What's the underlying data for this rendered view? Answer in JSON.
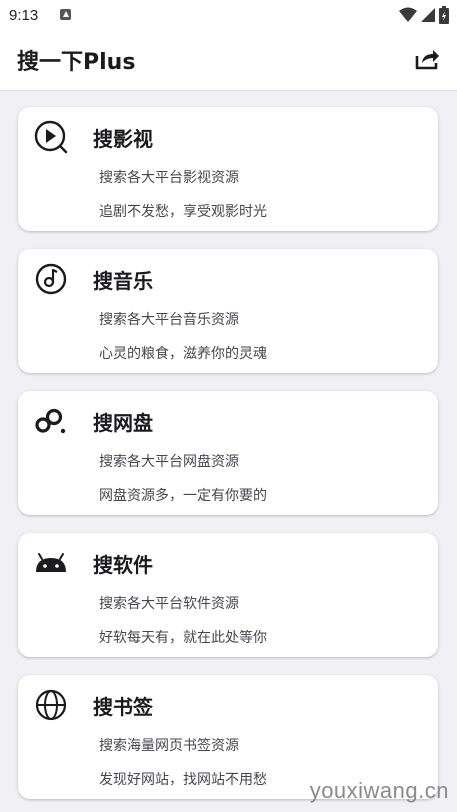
{
  "status_bar": {
    "time": "9:13"
  },
  "app_bar": {
    "title": "搜一下Plus",
    "share_icon": "share-icon"
  },
  "cards": [
    {
      "icon": "play-circle-icon",
      "title": "搜影视",
      "desc": "搜索各大平台影视资源",
      "slogan": "追剧不发愁，享受观影时光"
    },
    {
      "icon": "music-disc-icon",
      "title": "搜音乐",
      "desc": "搜索各大平台音乐资源",
      "slogan": "心灵的粮食，滋养你的灵魂"
    },
    {
      "icon": "cloud-drive-icon",
      "title": "搜网盘",
      "desc": "搜索各大平台网盘资源",
      "slogan": "网盘资源多，一定有你要的"
    },
    {
      "icon": "android-icon",
      "title": "搜软件",
      "desc": "搜索各大平台软件资源",
      "slogan": "好软每天有，就在此处等你"
    },
    {
      "icon": "globe-icon",
      "title": "搜书签",
      "desc": "搜索海量网页书签资源",
      "slogan": "发现好网站，找网站不用愁"
    }
  ],
  "watermark": "youxiwang.cn"
}
